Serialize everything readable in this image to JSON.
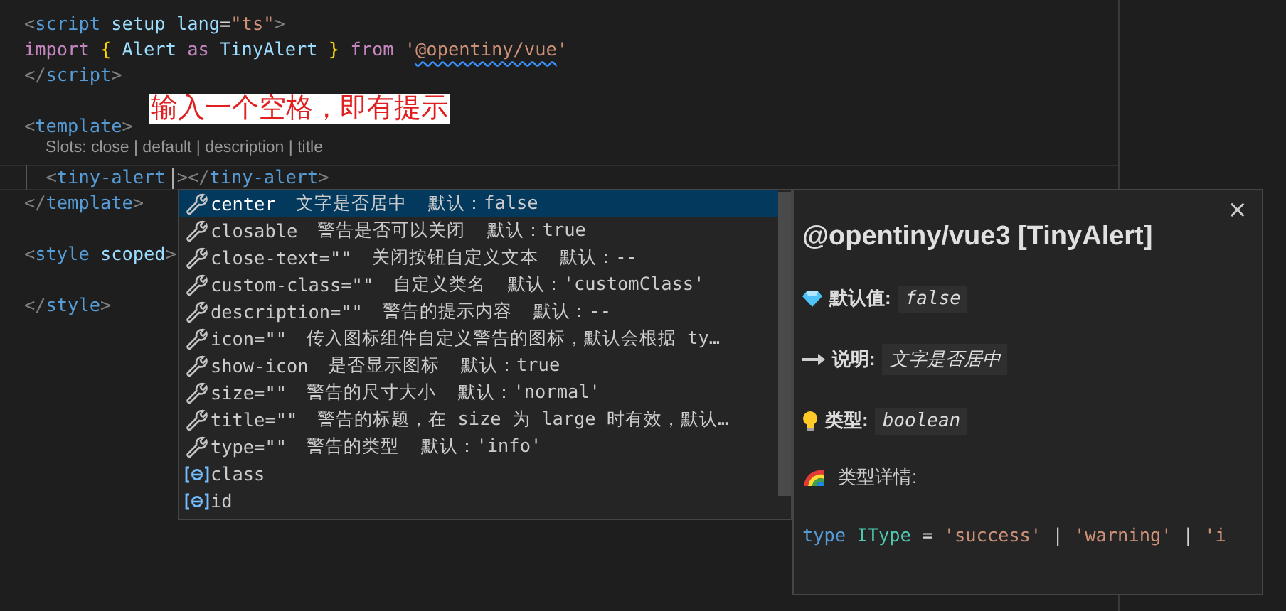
{
  "editor": {
    "lines": [
      {
        "kind": "code",
        "active": false,
        "tokens": [
          {
            "text": "<",
            "kind": "punct"
          },
          {
            "text": "script",
            "kind": "tag"
          },
          {
            "text": " setup",
            "kind": "attr"
          },
          {
            "text": " lang",
            "kind": "attr"
          },
          {
            "text": "=",
            "kind": "plain"
          },
          {
            "text": "\"ts\"",
            "kind": "string"
          },
          {
            "text": ">",
            "kind": "punct"
          }
        ]
      },
      {
        "kind": "code",
        "active": false,
        "tokens": [
          {
            "text": "import",
            "kind": "keyword"
          },
          {
            "text": " {",
            "kind": "brace"
          },
          {
            "text": " Alert",
            "kind": "var"
          },
          {
            "text": " as",
            "kind": "keyword"
          },
          {
            "text": " TinyAlert",
            "kind": "var"
          },
          {
            "text": " }",
            "kind": "brace"
          },
          {
            "text": " from",
            "kind": "keyword"
          },
          {
            "text": " '",
            "kind": "string"
          },
          {
            "text": "@opentiny/vue",
            "kind": "string",
            "squiggly": true
          },
          {
            "text": "'",
            "kind": "string"
          }
        ]
      },
      {
        "kind": "code",
        "active": false,
        "tokens": [
          {
            "text": "</",
            "kind": "punct"
          },
          {
            "text": "script",
            "kind": "tag"
          },
          {
            "text": ">",
            "kind": "punct"
          }
        ]
      },
      {
        "kind": "blank"
      },
      {
        "kind": "code",
        "active": false,
        "tokens": [
          {
            "text": "<",
            "kind": "punct"
          },
          {
            "text": "template",
            "kind": "tag"
          },
          {
            "text": ">",
            "kind": "punct"
          }
        ]
      },
      {
        "kind": "codelens",
        "text": "Slots: close | default | description | title"
      },
      {
        "kind": "code",
        "active": true,
        "tokens": [
          {
            "text": "  <",
            "kind": "punct"
          },
          {
            "text": "tiny-alert",
            "kind": "tag"
          },
          {
            "kind": "cursor"
          },
          {
            "text": ">",
            "kind": "punct"
          },
          {
            "text": "</",
            "kind": "punct"
          },
          {
            "text": "tiny-alert",
            "kind": "tag"
          },
          {
            "text": ">",
            "kind": "punct"
          }
        ]
      },
      {
        "kind": "code",
        "active": false,
        "tokens": [
          {
            "text": "</",
            "kind": "punct"
          },
          {
            "text": "template",
            "kind": "tag"
          },
          {
            "text": ">",
            "kind": "punct"
          }
        ]
      },
      {
        "kind": "blank"
      },
      {
        "kind": "code",
        "active": false,
        "tokens": [
          {
            "text": "<",
            "kind": "punct"
          },
          {
            "text": "style",
            "kind": "tag"
          },
          {
            "text": " scoped",
            "kind": "attr"
          },
          {
            "text": ">",
            "kind": "punct"
          }
        ]
      },
      {
        "kind": "blank"
      },
      {
        "kind": "code",
        "active": false,
        "tokens": [
          {
            "text": "</",
            "kind": "punct"
          },
          {
            "text": "style",
            "kind": "tag"
          },
          {
            "text": ">",
            "kind": "punct"
          }
        ]
      }
    ]
  },
  "annotation": {
    "text": "输入一个空格，即有提示"
  },
  "suggestions": [
    {
      "kind": "property",
      "label": "center",
      "detail": "文字是否居中  默认：false",
      "selected": true
    },
    {
      "kind": "property",
      "label": "closable",
      "detail": "警告是否可以关闭  默认：true",
      "selected": false
    },
    {
      "kind": "property",
      "label": "close-text=\"\"",
      "detail": "关闭按钮自定义文本  默认：--",
      "selected": false
    },
    {
      "kind": "property",
      "label": "custom-class=\"\"",
      "detail": "自定义类名  默认：'customClass'",
      "selected": false
    },
    {
      "kind": "property",
      "label": "description=\"\"",
      "detail": "警告的提示内容  默认：--",
      "selected": false
    },
    {
      "kind": "property",
      "label": "icon=\"\"",
      "detail": "传入图标组件自定义警告的图标，默认会根据 ty…",
      "selected": false
    },
    {
      "kind": "property",
      "label": "show-icon",
      "detail": "是否显示图标  默认：true",
      "selected": false
    },
    {
      "kind": "property",
      "label": "size=\"\"",
      "detail": "警告的尺寸大小  默认：'normal'",
      "selected": false
    },
    {
      "kind": "property",
      "label": "title=\"\"",
      "detail": "警告的标题，在 size 为 large 时有效，默认…",
      "selected": false
    },
    {
      "kind": "property",
      "label": "type=\"\"",
      "detail": "警告的类型  默认：'info'",
      "selected": false
    },
    {
      "kind": "field",
      "label": "class",
      "selected": false
    },
    {
      "kind": "field",
      "label": "id",
      "selected": false
    }
  ],
  "details": {
    "close": "×",
    "title": "@opentiny/vue3 [TinyAlert]",
    "fields": [
      {
        "kind": "default",
        "label": "默认值:",
        "value": "false"
      },
      {
        "kind": "description",
        "label": "说明:",
        "value": "文字是否居中"
      },
      {
        "kind": "type",
        "label": "类型:",
        "value": "boolean"
      }
    ],
    "type_details": {
      "kind": "details",
      "label": "类型详情:"
    },
    "code": [
      {
        "text": "type",
        "kind": "tkeyword"
      },
      {
        "text": " IType",
        "kind": "type"
      },
      {
        "text": " = ",
        "kind": "plain"
      },
      {
        "text": "'success'",
        "kind": "string"
      },
      {
        "text": " | ",
        "kind": "plain"
      },
      {
        "text": "'warning'",
        "kind": "string"
      },
      {
        "text": " | ",
        "kind": "plain"
      },
      {
        "text": "'i",
        "kind": "string"
      }
    ]
  }
}
